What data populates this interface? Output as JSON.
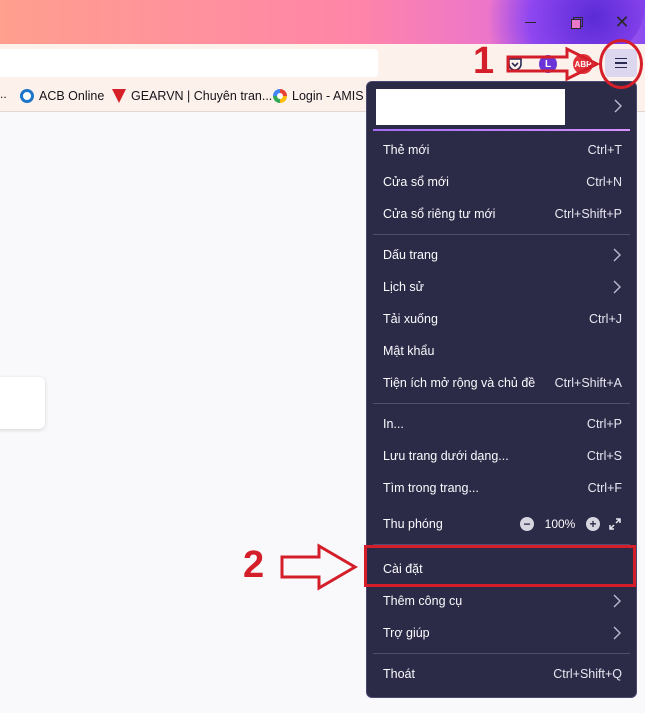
{
  "toolbar": {
    "avatar_letter": "L",
    "abp_label": "ABP"
  },
  "bookmarks": {
    "overflow": "..",
    "items": [
      {
        "label": "ACB Online"
      },
      {
        "label": "GEARVN | Chuyên tran..."
      },
      {
        "label": "Login - AMIS"
      }
    ]
  },
  "menu": {
    "group1": [
      {
        "label": "Thẻ mới",
        "shortcut": "Ctrl+T"
      },
      {
        "label": "Cửa sổ mới",
        "shortcut": "Ctrl+N"
      },
      {
        "label": "Cửa sổ riêng tư mới",
        "shortcut": "Ctrl+Shift+P"
      }
    ],
    "group2": [
      {
        "label": "Dấu trang",
        "shortcut": ""
      },
      {
        "label": "Lịch sử",
        "shortcut": ""
      },
      {
        "label": "Tải xuống",
        "shortcut": "Ctrl+J"
      },
      {
        "label": "Mật khẩu",
        "shortcut": ""
      },
      {
        "label": "Tiện ích mở rộng và chủ đề",
        "shortcut": "Ctrl+Shift+A"
      }
    ],
    "group3": [
      {
        "label": "In...",
        "shortcut": "Ctrl+P"
      },
      {
        "label": "Lưu trang dưới dạng...",
        "shortcut": "Ctrl+S"
      },
      {
        "label": "Tìm trong trang...",
        "shortcut": "Ctrl+F"
      }
    ],
    "zoom": {
      "label": "Thu phóng",
      "minus": "−",
      "value": "100%",
      "plus": "+"
    },
    "group4": [
      {
        "label": "Cài đặt"
      },
      {
        "label": "Thêm công cụ"
      },
      {
        "label": "Trợ giúp"
      }
    ],
    "quit": {
      "label": "Thoát",
      "shortcut": "Ctrl+Shift+Q"
    }
  },
  "annotations": {
    "step1": "1",
    "step2": "2",
    "color": "#d41f2b"
  },
  "colors": {
    "panel_bg": "#2b2a47",
    "accent": "#a36cf5"
  }
}
